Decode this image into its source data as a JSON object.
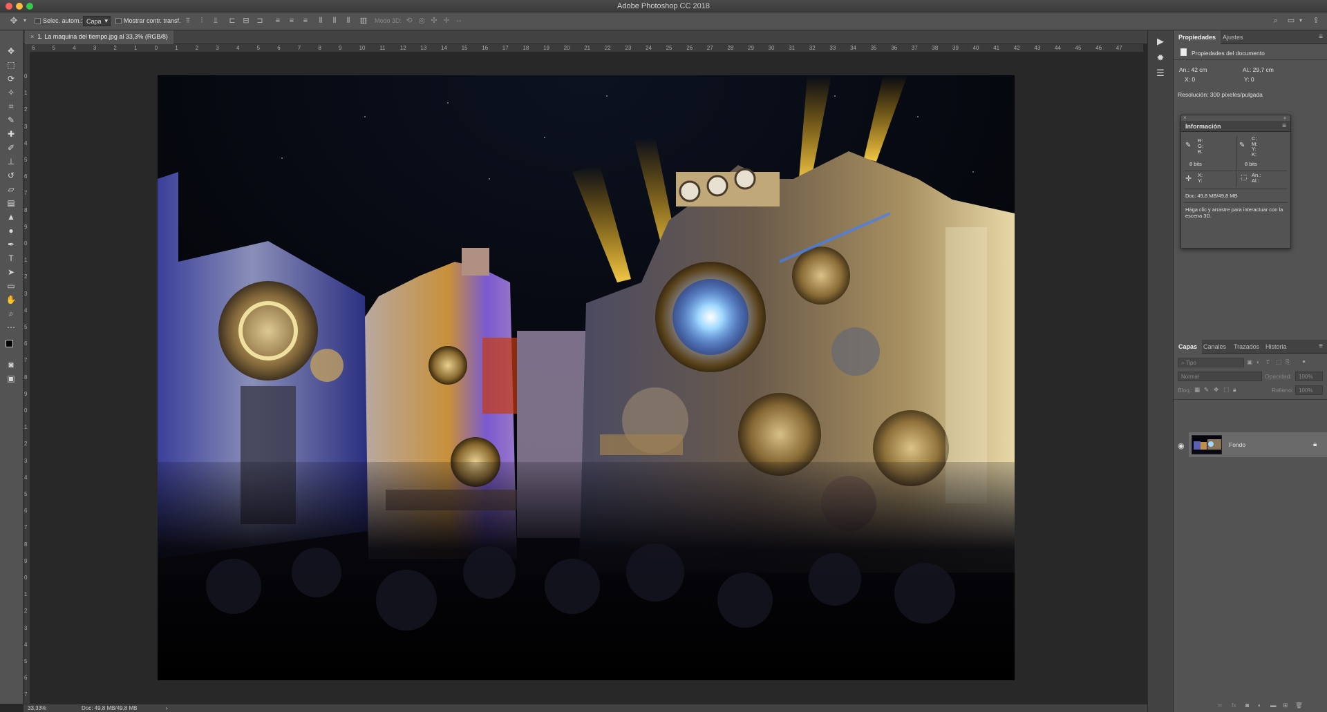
{
  "app": {
    "title": "Adobe Photoshop CC 2018"
  },
  "options_bar": {
    "auto_select_label": "Selec. autom.:",
    "auto_select_value": "Capa",
    "transform_label": "Mostrar contr. transf.",
    "mode3d_label": "Modo 3D:"
  },
  "document": {
    "tab_label": "1. La maquina del tiempo.jpg al 33,3% (RGB/8)",
    "zoom": "33,33%",
    "doc_size": "Doc: 49,8 MB/49,8 MB"
  },
  "ruler": {
    "top": [
      "6",
      "5",
      "4",
      "3",
      "2",
      "1",
      "0",
      "1",
      "2",
      "3",
      "4",
      "5",
      "6",
      "7",
      "8",
      "9",
      "10",
      "11",
      "12",
      "13",
      "14",
      "15",
      "16",
      "17",
      "18",
      "19",
      "20",
      "21",
      "22",
      "23",
      "24",
      "25",
      "26",
      "27",
      "28",
      "29",
      "30",
      "31",
      "32",
      "33",
      "34",
      "35",
      "36",
      "37",
      "38",
      "39",
      "40",
      "41",
      "42",
      "43",
      "44",
      "45",
      "46",
      "47"
    ],
    "left": [
      "0",
      "1",
      "2",
      "3",
      "4",
      "5",
      "6",
      "7",
      "8",
      "9",
      "0",
      "1",
      "2",
      "3",
      "4",
      "5",
      "6",
      "7",
      "8",
      "9",
      "0",
      "1",
      "2",
      "3",
      "4",
      "5",
      "6",
      "7",
      "8",
      "9",
      "0",
      "1",
      "2",
      "3",
      "4",
      "5",
      "6",
      "7"
    ]
  },
  "properties_panel": {
    "tabs": [
      "Propiedades",
      "Ajustes"
    ],
    "section_title": "Propiedades del documento",
    "width": "An.: 42 cm",
    "height": "Al.: 29,7 cm",
    "x": "X: 0",
    "y": "Y: 0",
    "resolution": "Resolución: 300 píxeles/pulgada"
  },
  "info_panel": {
    "title": "Información",
    "rgb_labels": [
      "R:",
      "G:",
      "B:"
    ],
    "cmyk_labels": [
      "C:",
      "M:",
      "Y:",
      "K:"
    ],
    "bits_left": "8 bits",
    "bits_right": "8 bits",
    "xy_labels": [
      "X:",
      "Y:"
    ],
    "wh_labels": [
      "An.:",
      "Al.:"
    ],
    "doc": "Doc: 49,8 MB/49,8 MB",
    "hint": "Haga clic y arrastre para interactuar con la escena 3D."
  },
  "layers_panel": {
    "tabs": [
      "Capas",
      "Canales",
      "Trazados",
      "Historia"
    ],
    "filter_placeholder": "Tipo",
    "blend_mode": "Normal",
    "opacity_label": "Opacidad:",
    "opacity_value": "100%",
    "lock_label": "Bloq.:",
    "fill_label": "Relleno:",
    "fill_value": "100%",
    "layers": [
      {
        "name": "Fondo",
        "locked": true,
        "visible": true
      }
    ]
  },
  "colors": {
    "panel": "#535353",
    "dark": "#424242",
    "canvas_bg": "#282828",
    "close_red": "#fc605c",
    "min_yellow": "#fdbc40",
    "max_green": "#34c84a"
  }
}
